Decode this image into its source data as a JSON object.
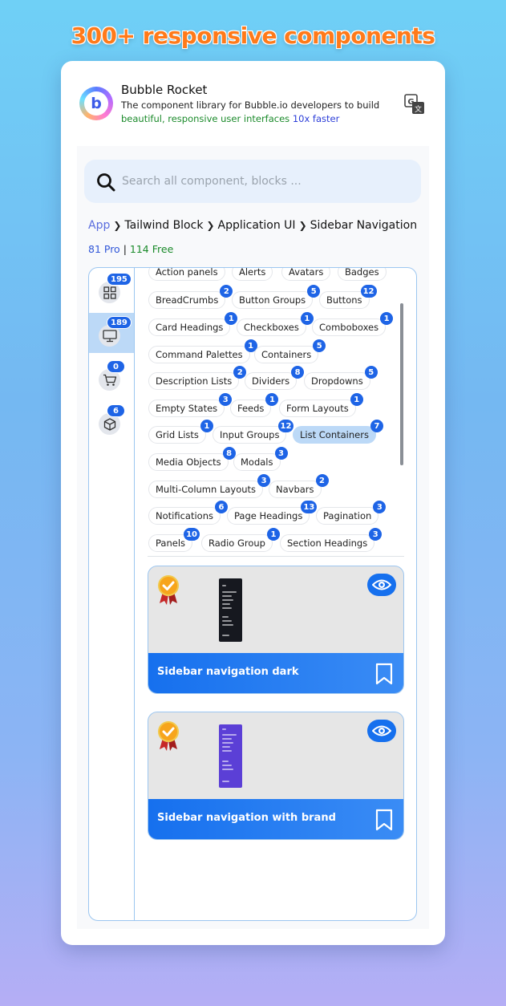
{
  "headline": "300+ responsive components",
  "header": {
    "app_name": "Bubble Rocket",
    "logo_letter": "b",
    "tagline_line1": "The component library for Bubble.io developers to build",
    "tagline_green": "beautiful, responsive user interfaces",
    "tagline_blue": "10x faster"
  },
  "search": {
    "placeholder": "Search all component, blocks ..."
  },
  "breadcrumb": [
    "App",
    "Tailwind Block",
    "Application UI",
    "Sidebar Navigation"
  ],
  "counts": {
    "pro": "81 Pro",
    "separator": "|",
    "free": "114 Free"
  },
  "rail": [
    {
      "icon": "grid-icon",
      "count": "195",
      "active": false
    },
    {
      "icon": "monitor-icon",
      "count": "189",
      "active": true
    },
    {
      "icon": "cart-icon",
      "count": "0",
      "active": false
    },
    {
      "icon": "box-icon",
      "count": "6",
      "active": false
    }
  ],
  "chips_partial": [
    "Action panels",
    "Alerts",
    "Avatars",
    "Badges"
  ],
  "chips": [
    {
      "label": "BreadCrumbs",
      "count": "2"
    },
    {
      "label": "Button Groups",
      "count": "5"
    },
    {
      "label": "Buttons",
      "count": "12"
    },
    {
      "label": "Card Headings",
      "count": "1"
    },
    {
      "label": "Checkboxes",
      "count": "1"
    },
    {
      "label": "Comboboxes",
      "count": "1"
    },
    {
      "label": "Command Palettes",
      "count": "1"
    },
    {
      "label": "Containers",
      "count": "5"
    },
    {
      "label": "Description Lists",
      "count": "2"
    },
    {
      "label": "Dividers",
      "count": "8"
    },
    {
      "label": "Dropdowns",
      "count": "5"
    },
    {
      "label": "Empty States",
      "count": "3"
    },
    {
      "label": "Feeds",
      "count": "1"
    },
    {
      "label": "Form Layouts",
      "count": "1"
    },
    {
      "label": "Grid Lists",
      "count": "1"
    },
    {
      "label": "Input Groups",
      "count": "12"
    },
    {
      "label": "List Containers",
      "count": "7",
      "active": true
    },
    {
      "label": "Media Objects",
      "count": "8"
    },
    {
      "label": "Modals",
      "count": "3"
    },
    {
      "label": "Multi-Column Layouts",
      "count": "3"
    },
    {
      "label": "Navbars",
      "count": "2"
    },
    {
      "label": "Notifications",
      "count": "6"
    },
    {
      "label": "Page Headings",
      "count": "13"
    },
    {
      "label": "Pagination",
      "count": "3"
    },
    {
      "label": "Panels",
      "count": "10"
    },
    {
      "label": "Radio Group",
      "count": "1"
    },
    {
      "label": "Section  Headings",
      "count": "3"
    }
  ],
  "cards": [
    {
      "title": "Sidebar navigation dark",
      "theme": "dark",
      "color": "#16181f"
    },
    {
      "title": "Sidebar navigation with brand",
      "theme": "brand",
      "color": "#5b3fd6"
    }
  ],
  "colors": {
    "accent": "#1670ee",
    "badge": "#1e64e6",
    "active": "#bcd9f7",
    "headline": "#ff7a1a"
  }
}
